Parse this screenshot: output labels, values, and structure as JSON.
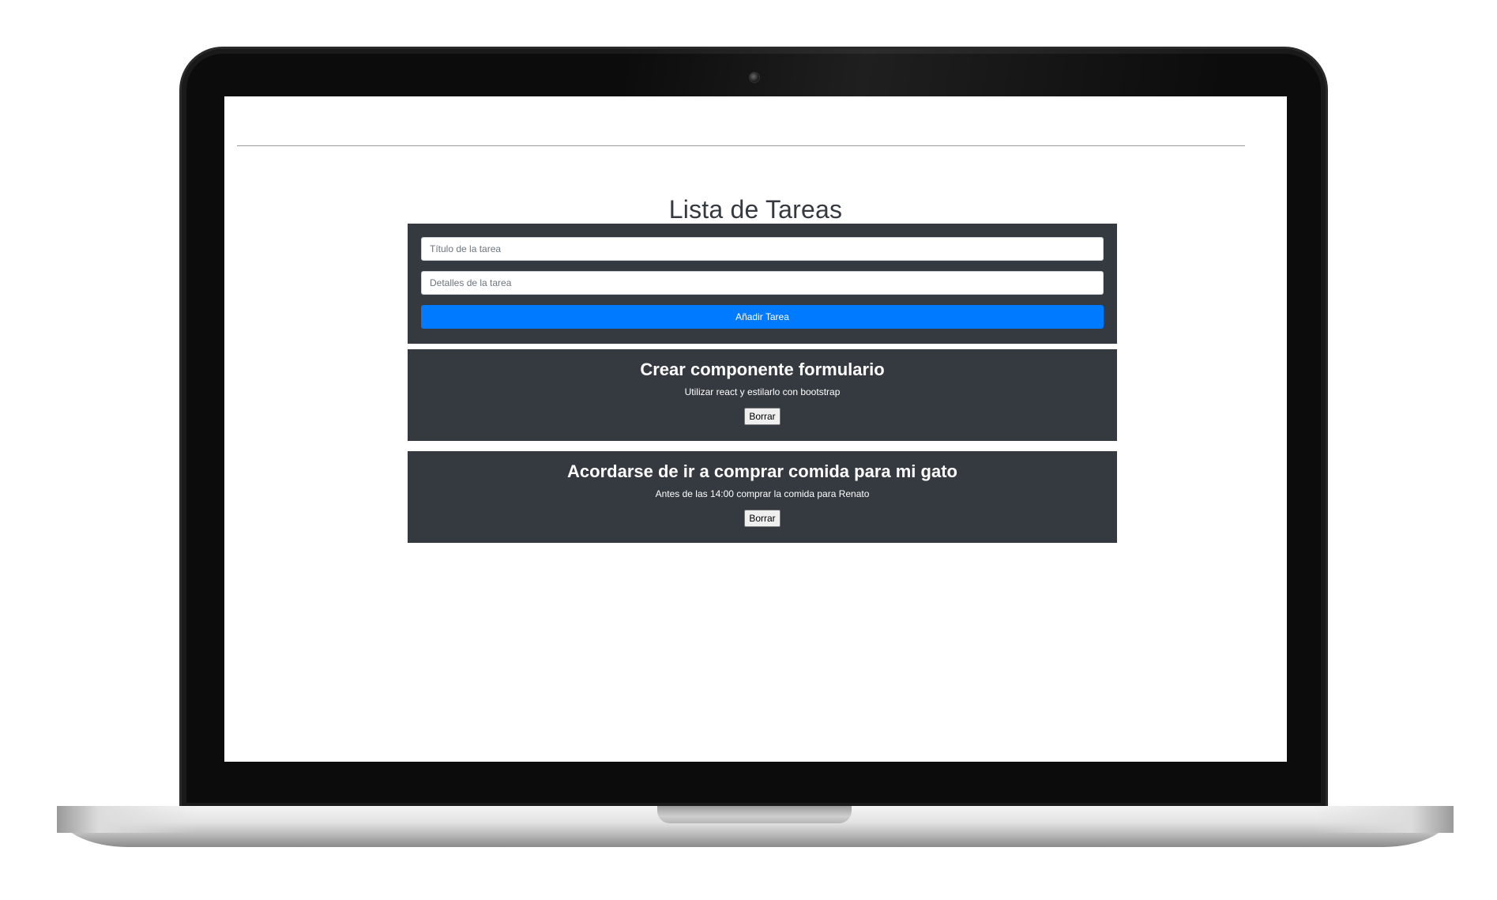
{
  "app": {
    "title": "Lista de Tareas"
  },
  "form": {
    "title_placeholder": "Título de la tarea",
    "details_placeholder": "Detalles de la tarea",
    "submit_label": "Añadir Tarea"
  },
  "tasks": [
    {
      "title": "Crear componente formulario",
      "description": "Utilizar react y estilarlo con bootstrap",
      "delete_label": "Borrar"
    },
    {
      "title": "Acordarse de ir a comprar comida para mi gato",
      "description": "Antes de las 14:00 comprar la comida para Renato",
      "delete_label": "Borrar"
    }
  ],
  "colors": {
    "card_bg": "#343a40",
    "primary": "#007bff",
    "heading": "#343a40"
  }
}
